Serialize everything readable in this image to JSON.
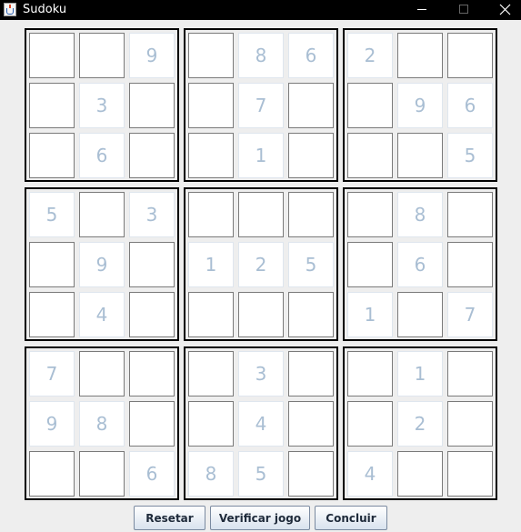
{
  "window": {
    "title": "Sudoku",
    "controls": [
      "minimize-icon",
      "maximize-icon",
      "close-icon"
    ]
  },
  "grid": [
    [
      "",
      "",
      "9",
      "",
      "8",
      "6",
      "2",
      "",
      ""
    ],
    [
      "",
      "3",
      "",
      "",
      "7",
      "",
      "",
      "9",
      "6"
    ],
    [
      "",
      "6",
      "",
      "",
      "1",
      "",
      "",
      "",
      "5"
    ],
    [
      "5",
      "",
      "3",
      "",
      "",
      "",
      "",
      "8",
      ""
    ],
    [
      "",
      "9",
      "",
      "1",
      "2",
      "5",
      "",
      "6",
      ""
    ],
    [
      "",
      "4",
      "",
      "",
      "",
      "",
      "1",
      "",
      "7"
    ],
    [
      "7",
      "",
      "",
      "",
      "3",
      "",
      "",
      "1",
      ""
    ],
    [
      "9",
      "8",
      "",
      "",
      "4",
      "",
      "",
      "2",
      ""
    ],
    [
      "",
      "",
      "6",
      "8",
      "5",
      "",
      "4",
      "",
      ""
    ]
  ],
  "buttons": {
    "reset": "Resetar",
    "verify": "Verificar jogo",
    "finish": "Concluir"
  },
  "colors": {
    "given_digit": "#a9bed3",
    "block_border": "#000000",
    "background": "#eeeeee"
  }
}
